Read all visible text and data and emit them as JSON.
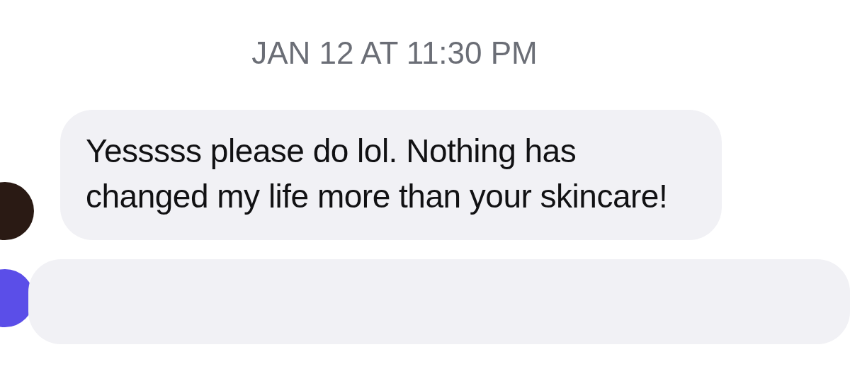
{
  "timestamp": "JAN 12 AT 11:30 PM",
  "messages": [
    {
      "text": "Yesssss please do lol. Nothing has changed my life more than your skincare!"
    }
  ]
}
